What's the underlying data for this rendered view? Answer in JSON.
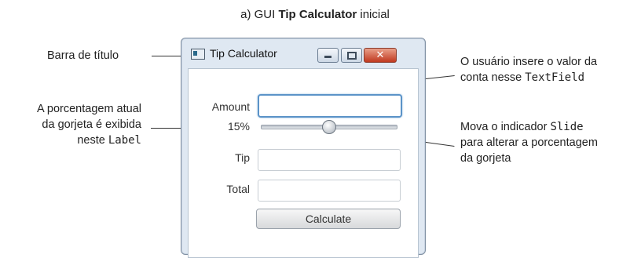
{
  "caption": {
    "prefix": "a) GUI ",
    "bold": "Tip Calculator",
    "suffix": " inicial"
  },
  "annotations": {
    "title_bar": "Barra de título",
    "percent_line1": "A porcentagem atual",
    "percent_line2": "da gorjeta é exibida",
    "percent_line3_text": "neste ",
    "percent_line3_code": "Label",
    "textfield_line1": "O usuário insere o valor da",
    "textfield_line2_text": "conta nesse ",
    "textfield_line2_code": "TextField",
    "slider_line1_text": "Mova o indicador ",
    "slider_line1_code": "Slide",
    "slider_line2": "para alterar a porcentagem",
    "slider_line3": "da gorjeta"
  },
  "window": {
    "title": "Tip Calculator",
    "close_glyph": "✕"
  },
  "form": {
    "amount_label": "Amount",
    "amount_value": "",
    "percent_label": "15%",
    "slider_value_percent": 15,
    "tip_label": "Tip",
    "tip_value": "",
    "total_label": "Total",
    "total_value": "",
    "calculate_button": "Calculate"
  },
  "colors": {
    "window_frame": "#dfe8f2",
    "focus_border": "#5b93c8",
    "close_button": "#c0391f"
  }
}
